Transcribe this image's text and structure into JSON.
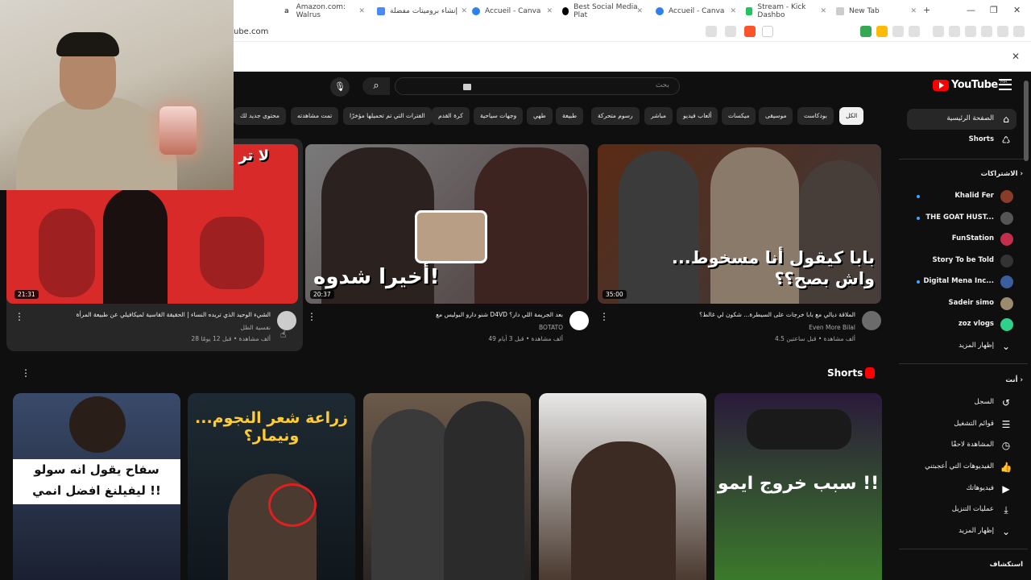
{
  "browser": {
    "tabs": [
      {
        "label": "Amazon.com: Walrus",
        "icon": "amazon-icon"
      },
      {
        "label": "إنشاء بروميتات مفضلة",
        "icon": "gemini-icon"
      },
      {
        "label": "Accueil - Canva",
        "icon": "canva-icon"
      },
      {
        "label": "Best Social Media Plat",
        "icon": "b-icon"
      },
      {
        "label": "Accueil - Canva",
        "icon": "canva-icon"
      },
      {
        "label": "Stream - Kick Dashbo",
        "icon": "kick-icon"
      },
      {
        "label": "New Tab",
        "icon": "shield-icon"
      }
    ],
    "new_tab": "+",
    "url": "ube.com",
    "infobar_close": "✕"
  },
  "youtube": {
    "logo_text": "YouTube",
    "region": "MA",
    "search_placeholder": "بحث",
    "chips": [
      "الكل",
      "بودكاست",
      "موسيقى",
      "ميكسات",
      "ألعاب فيديو",
      "مباشر",
      "رسوم متحركة",
      "طبيعة",
      "طهي",
      "وجهات سياحية",
      "كرة القدم",
      "الفترات التي تم تحميلها مؤخرًا",
      "تمت مشاهدته",
      "محتوى جديد لك"
    ],
    "sidebar": {
      "home": "الصفحة الرئيسية",
      "shorts": "Shorts",
      "subscriptions_header": "الاشتراكات",
      "subs": [
        {
          "name": "Khalid Fer",
          "color": "#8a3c2a",
          "dot": true
        },
        {
          "name": "THE GOAT HUST...",
          "color": "#555555",
          "dot": true
        },
        {
          "name": "FunStation",
          "color": "#c22f4a",
          "dot": false
        },
        {
          "name": "Story To be Told",
          "color": "#333333",
          "dot": false
        },
        {
          "name": "Digital Mena Inc...",
          "color": "#3a5f9c",
          "dot": true
        },
        {
          "name": "Sadeir simo",
          "color": "#9a8a6e",
          "dot": false
        },
        {
          "name": "zoz vlogs",
          "color": "#2fd18a",
          "dot": false
        }
      ],
      "show_more_1": "إظهار المزيد",
      "you_header": "أنت",
      "you_items": [
        {
          "label": "السجل",
          "icon": "history-icon",
          "glyph": "↺"
        },
        {
          "label": "قوائم التشغيل",
          "icon": "playlist-icon",
          "glyph": "☰"
        },
        {
          "label": "المشاهدة لاحقًا",
          "icon": "clock-icon",
          "glyph": "◷"
        },
        {
          "label": "الفيديوهات التي أعجبتني",
          "icon": "thumbs-up-icon",
          "glyph": "👍"
        },
        {
          "label": "فيديوهاتك",
          "icon": "video-icon",
          "glyph": "▶"
        },
        {
          "label": "عمليات التنزيل",
          "icon": "download-icon",
          "glyph": "⤓"
        }
      ],
      "show_more_2": "إظهار المزيد",
      "explore_header": "استكشاف"
    },
    "videos": [
      {
        "title": "الملاقة ديالي مع بابا خرجات على السيطرة... شكون لي غالط؟",
        "channel": "Even More Bilal",
        "meta": "4.5 ألف مشاهدة • قبل ساعتين",
        "duration": "35:00",
        "overlay": "بابا كيقول أنا مسخوط... واش بصح؟؟"
      },
      {
        "title": "شنو دارو البوليس مع D4VD بعد الجريمة اللي دار؟",
        "channel": "BOTATO",
        "meta": "49 ألف مشاهدة • قبل 3 أيام",
        "duration": "20:37",
        "overlay": "أخيرا شدوه!"
      },
      {
        "title": "الشيء الوحيد الذي تريده النساء | الحقيقة القاسية لميكافيلي عن طبيعة المرأة",
        "channel": "نفسية الظل",
        "meta": "28 ألف مشاهدة • قبل 12 يومًا",
        "duration": "21:31",
        "overlay": "لا تر"
      }
    ],
    "shorts_header": "Shorts",
    "shorts": [
      {
        "overlay": "سبب خروج ايمو !!",
        "color1": "#2a1a3a",
        "color2": "#3b7a2a"
      },
      {
        "overlay": "",
        "color1": "#5a4d44",
        "color2": "#2b2623"
      },
      {
        "overlay": "",
        "color1": "#6b5a4a",
        "color2": "#2a2624"
      },
      {
        "overlay": "زراعة شعر النجوم... ونيمار؟",
        "color1": "#1e2a33",
        "color2": "#10171c"
      },
      {
        "overlay": "سفاح يقول انه سولو ليفيلنغ افضل انمي !!",
        "color1": "#3a4a6a",
        "color2": "#1a2030"
      }
    ]
  }
}
